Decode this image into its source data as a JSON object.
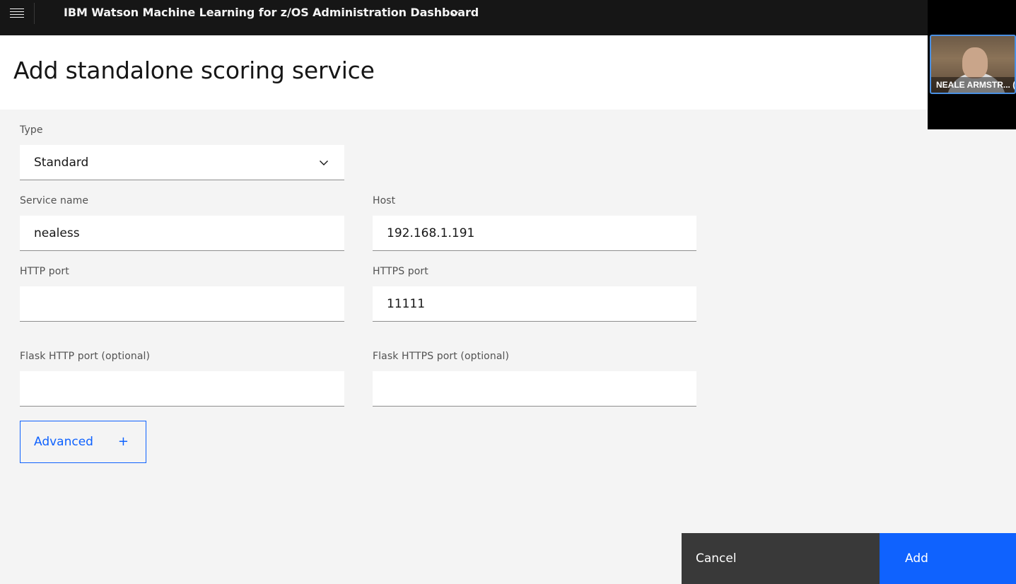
{
  "header": {
    "app_title": "IBM Watson Machine Learning for z/OS Administration Dashboard",
    "menu_icon": "hamburger-menu-icon",
    "switcher_icon": "chevron-down-icon"
  },
  "page": {
    "title": "Add standalone scoring service"
  },
  "form": {
    "type": {
      "label": "Type",
      "value": "Standard"
    },
    "service_name": {
      "label": "Service name",
      "value": "nealess"
    },
    "host": {
      "label": "Host",
      "value": "192.168.1.191"
    },
    "http_port": {
      "label": "HTTP port",
      "value": ""
    },
    "https_port": {
      "label": "HTTPS port",
      "value": "11111"
    },
    "flask_http_port": {
      "label": "Flask HTTP port (optional)",
      "value": ""
    },
    "flask_https_port": {
      "label": "Flask HTTPS port (optional)",
      "value": ""
    },
    "advanced": {
      "label": "Advanced",
      "expand_symbol": "+"
    }
  },
  "actions": {
    "cancel_label": "Cancel",
    "add_label": "Add"
  },
  "video_call": {
    "participant_name": "NEALE ARMSTR... (Ho"
  },
  "colors": {
    "header_bg": "#161616",
    "primary": "#0f62fe",
    "secondary_button": "#393939",
    "page_bg": "#f4f4f4"
  }
}
